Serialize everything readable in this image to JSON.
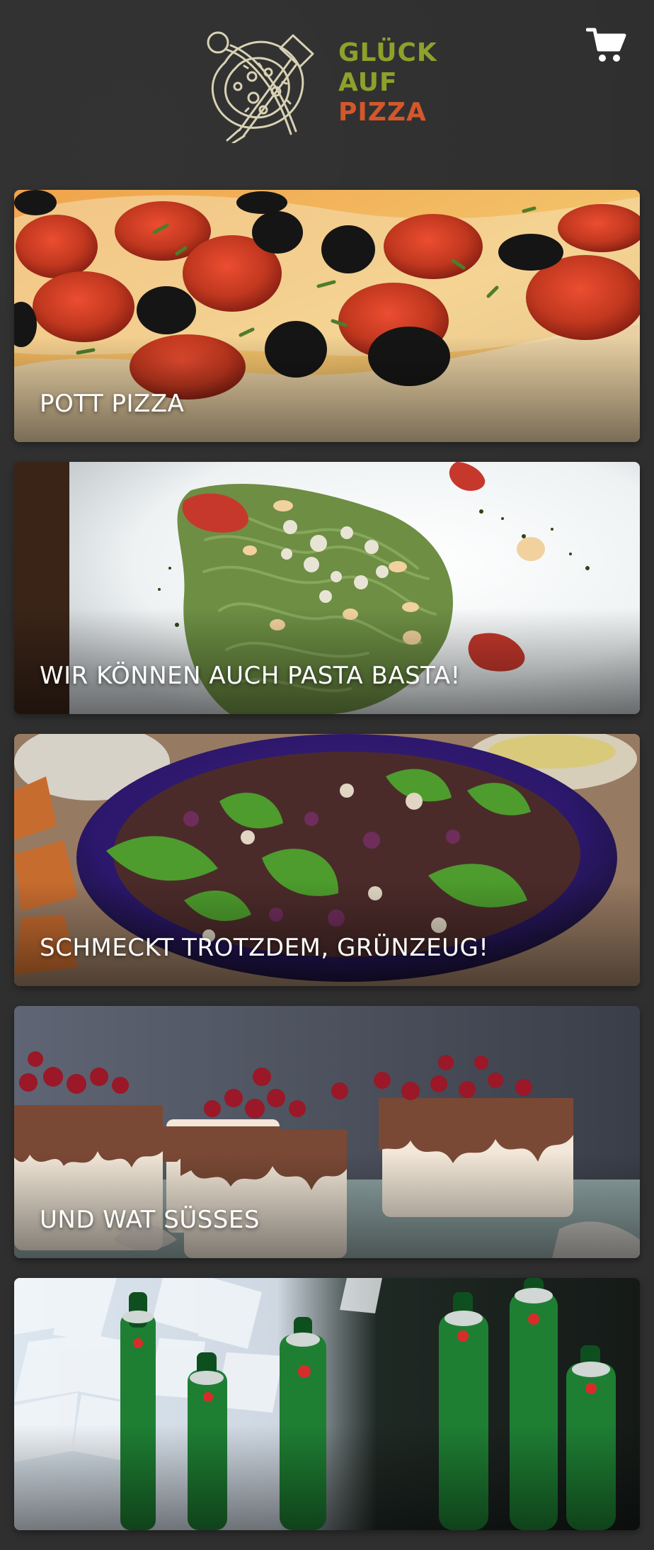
{
  "header": {
    "logo_lines": [
      "GLÜCK",
      "AUF",
      "PIZZA"
    ],
    "logo_mark_icon": "pizza-utensils-logo-icon",
    "cart_icon": "shopping-cart-icon"
  },
  "categories": [
    {
      "title": "POTT PIZZA",
      "image": "pizza-image"
    },
    {
      "title": "WIR KÖNNEN AUCH PASTA BASTA!",
      "image": "pasta-image"
    },
    {
      "title": "SCHMECKT TROTZDEM, GRÜNZEUG!",
      "image": "salad-image"
    },
    {
      "title": "UND WAT SÜSSES",
      "image": "dessert-image"
    },
    {
      "title": "",
      "image": "drinks-image"
    }
  ],
  "colors": {
    "background": "#2f2f2f",
    "logo_green": "#8da12b",
    "logo_red": "#d4572b",
    "text": "#ffffff"
  }
}
